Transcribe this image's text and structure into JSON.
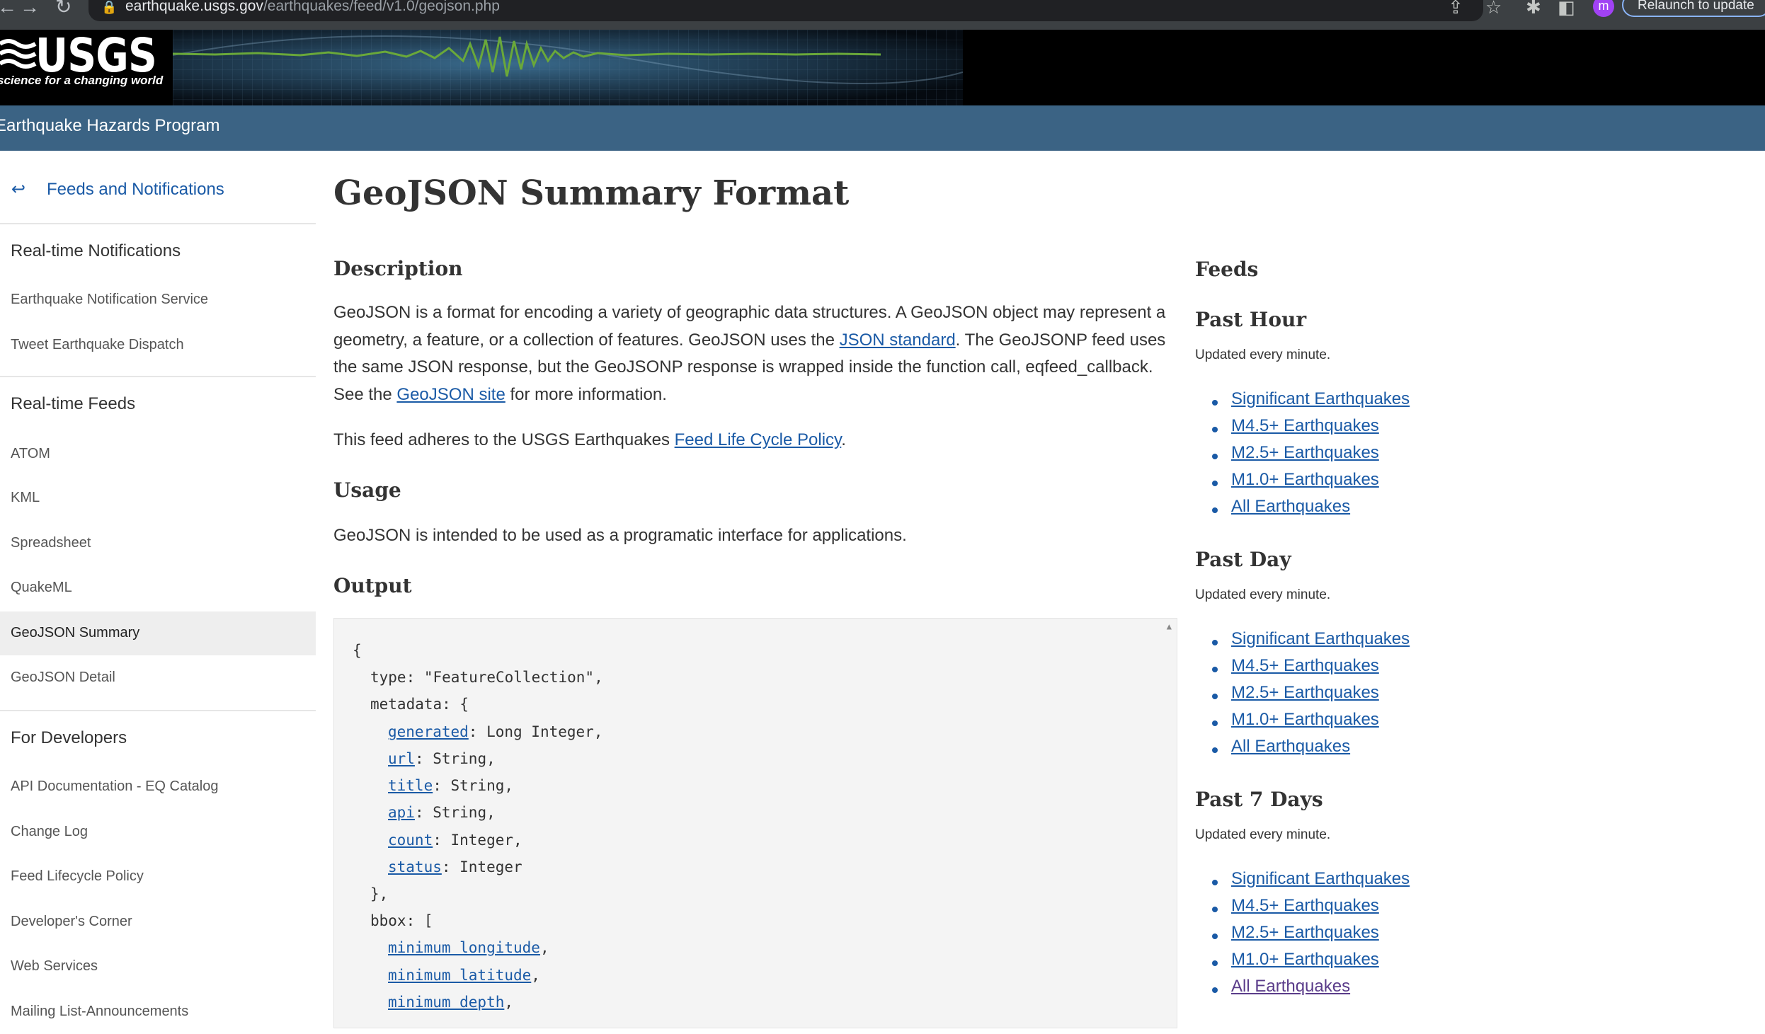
{
  "browser": {
    "back_icon": "arrow-back-icon",
    "url_host": "earthquake.usgs.gov",
    "url_path": "/earthquakes/feed/v1.0/geojson.php",
    "profile_initial": "m",
    "relaunch_label": "Relaunch to update"
  },
  "header": {
    "logo_text": "USGS",
    "tagline": "science for a changing world",
    "program": "Earthquake Hazards Program"
  },
  "sidebar": {
    "back_link": "Feeds and Notifications",
    "sections": [
      {
        "heading": "Real-time Notifications",
        "items": [
          "Earthquake Notification Service",
          "Tweet Earthquake Dispatch"
        ]
      },
      {
        "heading": "Real-time Feeds",
        "items": [
          "ATOM",
          "KML",
          "Spreadsheet",
          "QuakeML",
          "GeoJSON Summary",
          "GeoJSON Detail"
        ]
      },
      {
        "heading": "For Developers",
        "items": [
          "API Documentation - EQ Catalog",
          "Change Log",
          "Feed Lifecycle Policy",
          "Developer's Corner",
          "Web Services",
          "Mailing List-Announcements"
        ]
      }
    ],
    "active_item": "GeoJSON Summary"
  },
  "main": {
    "title": "GeoJSON Summary Format",
    "description_heading": "Description",
    "description_p1_a": "GeoJSON is a format for encoding a variety of geographic data structures. A GeoJSON object may represent a geometry, a feature, or a collection of features. GeoJSON uses the ",
    "json_standard_link": "JSON standard",
    "description_p1_b": ". The GeoJSONP feed uses the same JSON response, but the GeoJSONP response is wrapped inside the function call, eqfeed_callback. See the ",
    "geojson_site_link": "GeoJSON site",
    "description_p1_c": " for more information.",
    "policy_a": "This feed adheres to the USGS Earthquakes ",
    "policy_link": "Feed Life Cycle Policy",
    "policy_b": ".",
    "usage_heading": "Usage",
    "usage_text": "GeoJSON is intended to be used as a programatic interface for applications.",
    "output_heading": "Output"
  },
  "code": {
    "l1": "{",
    "l2": "type: \"FeatureCollection\",",
    "l3": "metadata: {",
    "fields": [
      {
        "name": "generated",
        "rest": ": Long Integer,"
      },
      {
        "name": "url",
        "rest": ": String,"
      },
      {
        "name": "title",
        "rest": ": String,"
      },
      {
        "name": "api",
        "rest": ": String,"
      },
      {
        "name": "count",
        "rest": ": Integer,"
      },
      {
        "name": "status",
        "rest": ": Integer"
      }
    ],
    "l10": "},",
    "l11": "bbox: [",
    "bbox": [
      {
        "name": "minimum longitude",
        "rest": ","
      },
      {
        "name": "minimum latitude",
        "rest": ","
      },
      {
        "name": "minimum depth",
        "rest": ","
      }
    ]
  },
  "feeds": {
    "title": "Feeds",
    "updated_note": "Updated every minute.",
    "groups": [
      {
        "heading": "Past Hour"
      },
      {
        "heading": "Past Day"
      },
      {
        "heading": "Past 7 Days"
      }
    ],
    "links": [
      "Significant Earthquakes",
      "M4.5+ Earthquakes",
      "M2.5+ Earthquakes",
      "M1.0+ Earthquakes",
      "All Earthquakes"
    ]
  },
  "colors": {
    "link": "#1a5aa6",
    "program_bar": "#3b6384",
    "seismograph": "#6aa83a"
  }
}
